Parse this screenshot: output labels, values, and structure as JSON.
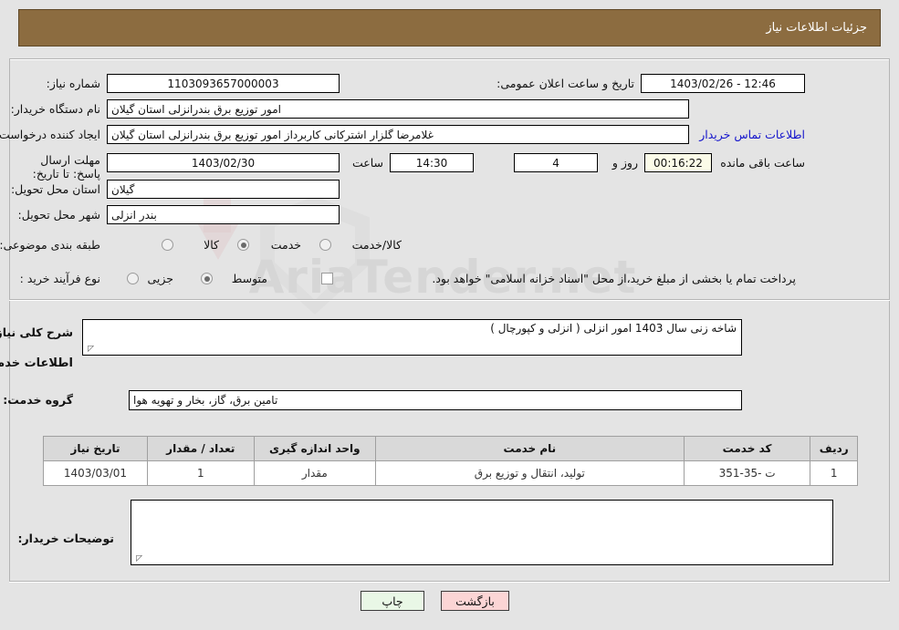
{
  "window": {
    "title": "جزئیات اطلاعات نیاز",
    "header_bg": "#8c6c40",
    "page_bg": "#e4e4e4"
  },
  "watermark": {
    "text": "AriaTender.net"
  },
  "summary": {
    "need_number": {
      "label": "شماره نیاز:",
      "value": "1103093657000003"
    },
    "buyer_org": {
      "label": "نام دستگاه خریدار:",
      "value": "امور توزیع برق بندرانزلی استان گیلان"
    },
    "requester": {
      "label": "ایجاد کننده درخواست:",
      "value": "غلامرضا گلزار اشترکانی کاربرداز امور توزیع برق بندرانزلی استان گیلان"
    },
    "contact_link": "اطلاعات تماس خریدار",
    "announce_date": {
      "label": "تاریخ و ساعت اعلان عمومی:",
      "value": "12:46 - 1403/02/26"
    },
    "deadline": {
      "label": "مهلت ارسال پاسخ: تا تاریخ:",
      "date": "1403/02/30",
      "hour_label": "ساعت",
      "time": "14:30",
      "days": "4",
      "days_label": "روز و",
      "countdown": "00:16:22",
      "remaining_label": "ساعت باقی مانده"
    },
    "province": {
      "label": "استان محل تحویل:",
      "value": "گیلان"
    },
    "city": {
      "label": "شهر محل تحویل:",
      "value": "بندر انزلی"
    },
    "category": {
      "label": "طبقه بندی موضوعی:",
      "options": [
        "کالا",
        "خدمت",
        "کالا/خدمت"
      ],
      "selected": "خدمت"
    },
    "process": {
      "label": "نوع فرآیند خرید :",
      "options": [
        "جزیی",
        "متوسط"
      ],
      "selected": "متوسط",
      "checkbox_checked": false,
      "note": "پرداخت تمام یا بخشی از مبلغ خرید،از محل \"اسناد خزانه اسلامی\" خواهد بود."
    }
  },
  "details": {
    "general_desc": {
      "label": "شرح کلی نیاز:",
      "value": "شاخه زنی سال 1403 امور انزلی ( انزلی و کپورچال )"
    },
    "section_title": "اطلاعات خدمات مورد نیاز",
    "service_group": {
      "label": "گروه خدمت:",
      "value": "تامین برق، گاز، بخار و تهویه هوا"
    },
    "table": {
      "columns": [
        "ردیف",
        "کد خدمت",
        "نام خدمت",
        "واحد اندازه گیری",
        "تعداد / مقدار",
        "تاریخ نیاز"
      ],
      "rows": [
        {
          "row_no": "1",
          "service_code": "ت -35-351",
          "service_name": "تولید، انتقال و توزیع برق",
          "unit": "مقدار",
          "quantity": "1",
          "need_date": "1403/03/01"
        }
      ]
    },
    "buyer_comments": {
      "label": "توضیحات خریدار:",
      "value": ""
    }
  },
  "footer": {
    "print_label": "چاپ",
    "back_label": "بازگشت"
  }
}
